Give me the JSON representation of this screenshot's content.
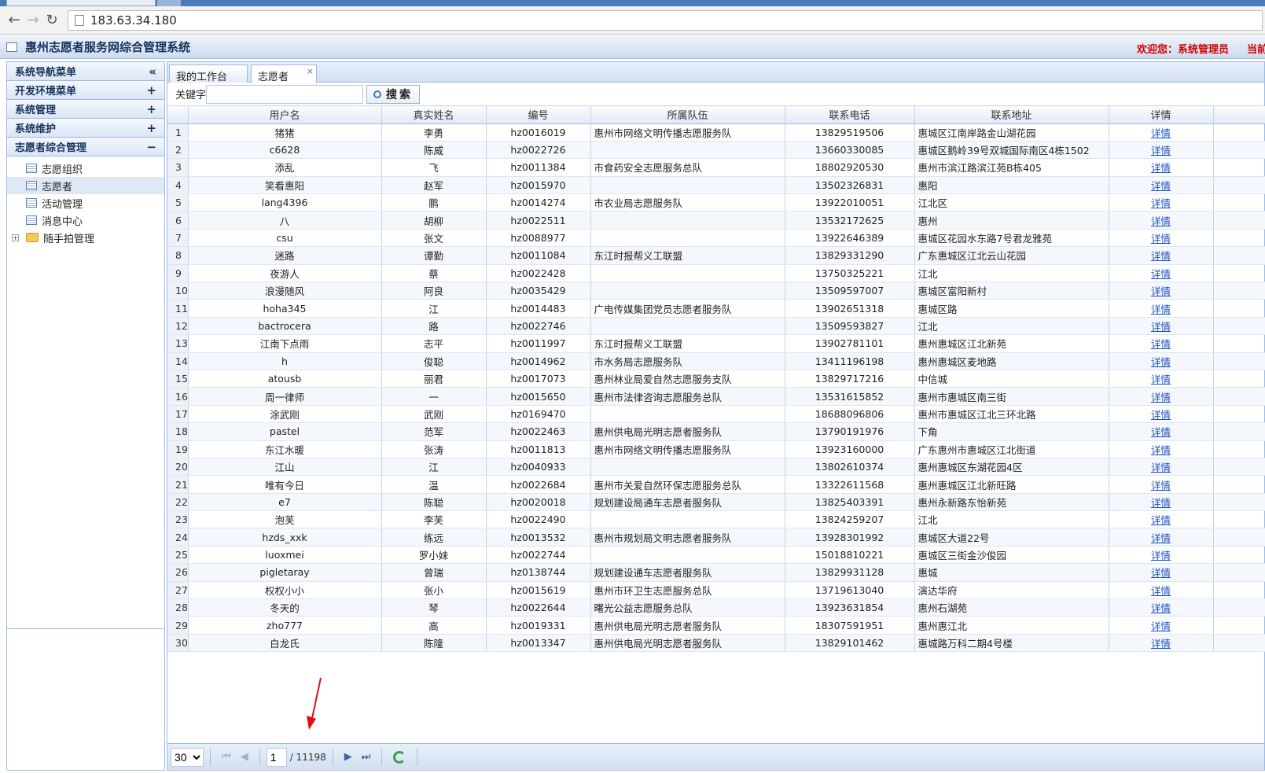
{
  "browser": {
    "url": "183.63.34.180"
  },
  "header": {
    "title": "惠州志愿者服务网综合管理系统",
    "welcome": "欢迎您：系统管理员",
    "current": "当前"
  },
  "sidebar": {
    "sections": [
      {
        "label": "系统导航菜单",
        "toggle": "«"
      },
      {
        "label": "开发环境菜单",
        "toggle": "+"
      },
      {
        "label": "系统管理",
        "toggle": "+"
      },
      {
        "label": "系统维护",
        "toggle": "+"
      },
      {
        "label": "志愿者综合管理",
        "toggle": "−"
      }
    ],
    "tree": [
      {
        "label": "志愿组织"
      },
      {
        "label": "志愿者"
      },
      {
        "label": "活动管理"
      },
      {
        "label": "消息中心"
      },
      {
        "label": "随手拍管理",
        "expander": "+"
      }
    ]
  },
  "tabs": [
    {
      "label": "我的工作台"
    },
    {
      "label": "志愿者",
      "close": "×"
    }
  ],
  "toolbar": {
    "keyword_label": "关键字",
    "keyword_value": "",
    "search_label": "搜索"
  },
  "grid": {
    "columns": [
      "用户名",
      "真实姓名",
      "编号",
      "所属队伍",
      "联系电话",
      "联系地址",
      "详情"
    ],
    "detail_label": "详情",
    "rows": [
      [
        "1",
        "猪猪",
        "李勇",
        "hz0016019",
        "惠州市网络文明传播志愿服务队",
        "13829519506",
        "惠城区江南岸路金山湖花园"
      ],
      [
        "2",
        "c6628",
        "陈威",
        "hz0022726",
        "",
        "13660330085",
        "惠城区鹅岭39号双城国际南区4栋1502"
      ],
      [
        "3",
        "添乱",
        "飞",
        "hz0011384",
        "市食药安全志愿服务总队",
        "18802920530",
        "惠州市滨江路滨江苑B栋405"
      ],
      [
        "4",
        "笑看惠阳",
        "赵军",
        "hz0015970",
        "",
        "13502326831",
        "惠阳"
      ],
      [
        "5",
        "lang4396",
        "鹏",
        "hz0014274",
        "市农业局志愿服务队",
        "13922010051",
        "江北区"
      ],
      [
        "6",
        "八",
        "胡柳",
        "hz0022511",
        "",
        "13532172625",
        "惠州"
      ],
      [
        "7",
        "csu",
        "张文",
        "hz0088977",
        "",
        "13922646389",
        "惠城区花园水东路7号君龙雅苑"
      ],
      [
        "8",
        "迷路",
        "谭勤",
        "hz0011084",
        "东江时报帮义工联盟",
        "13829331290",
        "广东惠城区江北云山花园"
      ],
      [
        "9",
        "夜游人",
        "蔡",
        "hz0022428",
        "",
        "13750325221",
        "江北"
      ],
      [
        "10",
        "浪漫随风",
        "阿良",
        "hz0035429",
        "",
        "13509597007",
        "惠城区富阳新村"
      ],
      [
        "11",
        "hoha345",
        "江",
        "hz0014483",
        "广电传媒集团党员志愿者服务队",
        "13902651318",
        "惠城区路"
      ],
      [
        "12",
        "bactrocera",
        "路",
        "hz0022746",
        "",
        "13509593827",
        "江北"
      ],
      [
        "13",
        "江南下点雨",
        "志平",
        "hz0011997",
        "东江时报帮义工联盟",
        "13902781101",
        "惠州惠城区江北新苑"
      ],
      [
        "14",
        "h",
        "俊聪",
        "hz0014962",
        "市水务局志愿服务队",
        "13411196198",
        "惠州惠城区麦地路"
      ],
      [
        "15",
        "atousb",
        "丽君",
        "hz0017073",
        "惠州林业局爱自然志愿服务支队",
        "13829717216",
        "中信城"
      ],
      [
        "16",
        "周一律师",
        "一",
        "hz0015650",
        "惠州市法律咨询志愿服务总队",
        "13531615852",
        "惠州市惠城区南三街"
      ],
      [
        "17",
        "涂武刚",
        "武刚",
        "hz0169470",
        "",
        "18688096806",
        "惠州市惠城区江北三环北路"
      ],
      [
        "18",
        "pastel",
        "范军",
        "hz0022463",
        "惠州供电局光明志愿者服务队",
        "13790191976",
        "下角"
      ],
      [
        "19",
        "东江水暖",
        "张涛",
        "hz0011813",
        "惠州市网络文明传播志愿服务队",
        "13923160000",
        "广东惠州市惠城区江北街道"
      ],
      [
        "20",
        "江山",
        "江",
        "hz0040933",
        "",
        "13802610374",
        "惠州惠城区东湖花园4区"
      ],
      [
        "21",
        "唯有今日",
        "温",
        "hz0022684",
        "惠州市关爱自然环保志愿服务总队",
        "13322611568",
        "惠州惠城区江北新旺路"
      ],
      [
        "22",
        "e7",
        "陈聪",
        "hz0020018",
        "规划建设局通车志愿者服务队",
        "13825403391",
        "惠州永新路东怡新苑"
      ],
      [
        "23",
        "泡芙",
        "李芙",
        "hz0022490",
        "",
        "13824259207",
        "江北"
      ],
      [
        "24",
        "hzds_xxk",
        "练远",
        "hz0013532",
        "惠州市规划局文明志愿者服务队",
        "13928301992",
        "惠城区大道22号"
      ],
      [
        "25",
        "luoxmei",
        "罗小妹",
        "hz0022744",
        "",
        "15018810221",
        "惠城区三街金沙俊园"
      ],
      [
        "26",
        "pigletaray",
        "曾瑞",
        "hz0138744",
        "规划建设通车志愿者服务队",
        "13829931128",
        "惠城"
      ],
      [
        "27",
        "权权小小",
        "张小",
        "hz0015619",
        "惠州市环卫生志愿服务总队",
        "13719613040",
        "演达华府"
      ],
      [
        "28",
        "冬天的",
        "琴",
        "hz0022644",
        "曙光公益志愿服务总队",
        "13923631854",
        "惠州石湖苑"
      ],
      [
        "29",
        "zho777",
        "高",
        "hz0019331",
        "惠州供电局光明志愿者服务队",
        "18307591951",
        "惠州惠江北"
      ],
      [
        "30",
        "白龙氏",
        "陈隆",
        "hz0013347",
        "惠州供电局光明志愿者服务队",
        "13829101462",
        "惠城路万科二期4号楼"
      ]
    ]
  },
  "pager": {
    "page_size": "30",
    "page_input": "1",
    "total_pages": "/ 11198"
  },
  "colors": {
    "accent_blue": "#99bbe8",
    "link": "#1a4fc6",
    "welcome_red": "#d40000",
    "arrow_red": "#e01010"
  }
}
